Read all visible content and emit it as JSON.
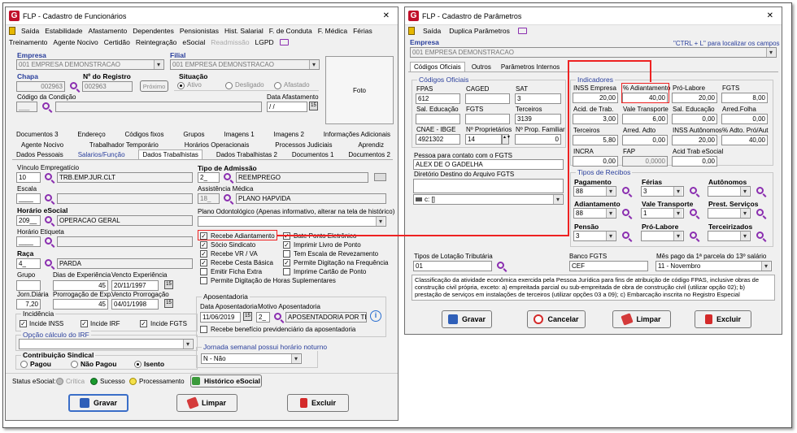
{
  "left": {
    "title": "FLP - Cadastro de Funcionários",
    "close": "✕",
    "menu1": [
      "Saída",
      "Estabilidade",
      "Afastamento",
      "Dependentes",
      "Pensionistas",
      "Hist. Salarial",
      "F. de Conduta",
      "F. Médica",
      "Férias"
    ],
    "menu2": [
      "Treinamento",
      "Agente Nocivo",
      "Certidão",
      "Reintegração",
      "eSocial",
      "Readmissão",
      "LGPD"
    ],
    "empresa_label": "Empresa",
    "empresa_value": "001 EMPRESA DEMONSTRACAO",
    "filial_label": "Filial",
    "filial_value": "001 EMPRESA DEMONSTRACAO",
    "chapa_label": "Chapa",
    "chapa_value": "002963",
    "registro_label": "Nº do Registro",
    "registro_value": "002963",
    "proximo": "Próximo",
    "situacao_label": "Situação",
    "sit_ativo": "Ativo",
    "sit_desligado": "Desligado",
    "sit_afastado": "Afastado",
    "foto": "Foto",
    "cond_label": "Código da Condição",
    "cond_value": "___",
    "dafast_label": "Data Afastamento",
    "dafast_value": "/ /",
    "tabs1": [
      "Documentos 3",
      "Endereço",
      "Códigos fixos",
      "Grupos",
      "Imagens 1",
      "Imagens 2",
      "Informações Adicionais"
    ],
    "tabs2": [
      "Agente Nocivo",
      "Trabalhador Temporário",
      "Horários Operacionais",
      "Processos Judiciais",
      "Aprendiz"
    ],
    "tabs3": [
      "Dados Pessoais",
      "Salarios/Função",
      "Dados Trabalhistas",
      "Dados Trabalhistas 2",
      "Documentos 1",
      "Documentos 2"
    ],
    "vinc_label": "Vínculo Empregatício",
    "vinc_code": "10",
    "vinc_desc": "TRB.EMP.JUR.CLT",
    "escala_label": "Escala",
    "escala_code": "____",
    "hor_label": "Horário eSocial",
    "hor_code": "209__",
    "hor_desc": "OPERACAO GERAL",
    "horet_label": "Horário Etiqueta",
    "horet_code": "____",
    "raca_label": "Raça",
    "raca_code": "4_",
    "raca_desc": "PARDA",
    "grupo_label": "Grupo",
    "grupo_value": "",
    "diasexp_label": "Dias de Experiência",
    "diasexp_value": "45",
    "vencexp_label": "Vencto Experiência",
    "vencexp_value": "20/11/1997",
    "jorn_label": "Jorn.Diária",
    "jorn_value": "7,20",
    "prorrog_label": "Prorrogação de Exp.",
    "prorrog_value": "45",
    "vencpro_label": "Vencto Prorrogação",
    "vencpro_value": "04/01/1998",
    "incid_label": "Incidência",
    "inss": "Incide INSS",
    "irf": "Incide IRF",
    "fgts": "Incide FGTS",
    "opcirf_label": "Opção cálculo do IRF",
    "contrib_label": "Contribuição Sindical",
    "pagou": "Pagou",
    "naopagou": "Não Pagou",
    "isento": "Isento",
    "tipoadm_label": "Tipo de Admissão",
    "tipoadm_code": "2_",
    "tipoadm_desc": "REEMPREGO",
    "assist_label": "Assistência Médica",
    "assist_code": "18_",
    "assist_desc": "PLANO HAPVIDA",
    "plano_label": "Plano Odontológico (Apenas informativo, alterar na tela de histórico)",
    "checks_left": [
      "Recebe Adiantamento",
      "Sócio Sindicato",
      "Recebe VR / VA",
      "Recebe Cesta Básica",
      "Emitir Ficha Extra",
      "Permite Digitação de Horas Suplementares"
    ],
    "checks_right": [
      "Bate Ponto Eletrônico",
      "Imprimir Livro de Ponto",
      "Tem Escala de Revezamento",
      "Permite Digitação na Frequência",
      "Imprime Cartão de Ponto"
    ],
    "apos_label": "Aposentadoria",
    "apos_data_label": "Data Aposentadoria",
    "apos_motivo_label": "Motivo Aposentadoria",
    "apos_data": "11/06/2019",
    "apos_code": "2_",
    "apos_desc": "APOSENTADORIA POR TEI",
    "apos_benef": "Recebe benefício previdenciário da aposentadoria",
    "jornada_label": "Jornada semanal possui horário noturno",
    "jornada_value": "N - Não",
    "status_label": "Status eSocial:",
    "st_critica": "Crítica",
    "st_sucesso": "Sucesso",
    "st_process": "Processamento",
    "hist": "Histórico eSocial",
    "gravar": "Gravar",
    "limpar": "Limpar",
    "excluir": "Excluir"
  },
  "right": {
    "title": "FLP - Cadastro de Parâmetros",
    "menu": [
      "Saída",
      "Duplica Parâmetros"
    ],
    "empresa_label": "Empresa",
    "empresa_value": "001 EMPRESA DEMONSTRACAO",
    "hint": "\"CTRL + L\" para localizar os campos",
    "tabs": [
      "Códigos Oficiais",
      "Outros",
      "Parâmetros Internos"
    ],
    "cod_label": "Códigos Oficiais",
    "fpas_label": "FPAS",
    "fpas": "612",
    "caged_label": "CAGED",
    "caged": "",
    "sat_label": "SAT",
    "sat": "3",
    "saled_label": "Sal. Educação",
    "saled": "",
    "fgts_label": "FGTS",
    "fgts": "",
    "terc_label": "Terceiros",
    "terc": "3139",
    "cnae_label": "CNAE - IBGE",
    "cnae": "4921302",
    "nprop_label": "Nº Proprietários",
    "nprop": "14",
    "nfam_label": "Nº Prop. Familiar",
    "nfam": "0",
    "contato_label": "Pessoa para contato com o FGTS",
    "contato": "ALEX DE O GADELHA",
    "dir_label": "Diretório Destino do Arquivo FGTS",
    "drive": "c: []",
    "ind_label": "Indicadores",
    "inss_emp_l": "INSS Empresa",
    "inss_emp": "20,00",
    "pct_adi_l": "% Adiantamento",
    "pct_adi": "40,00",
    "prolab_l": "Pró-Labore",
    "prolab": "20,00",
    "fgts2_l": "FGTS",
    "fgts2": "8,00",
    "acid_l": "Acid. de Trab.",
    "acid": "3,00",
    "vt_l": "Vale Transporte",
    "vt": "6,00",
    "saled2_l": "Sal. Educação",
    "saled2": "0,00",
    "arredf_l": "Arred.Folha",
    "arredf": "0,00",
    "terc2_l": "Terceiros",
    "terc2": "5,80",
    "arred_adto_l": "Arred. Adto",
    "arred_adto": "0,00",
    "inss_aut_l": "INSS Autônomos",
    "inss_aut": "20,00",
    "pct_aut_l": "% Adto. Pró/Aut",
    "pct_aut": "40,00",
    "incra_l": "INCRA",
    "incra": "0,00",
    "fap_l": "FAP",
    "fap": "0,0000",
    "acidrab_l": "Acid Trab eSocial",
    "acidrab": "0,00",
    "tiporec_label": "Tipos de Recibos",
    "pag_l": "Pagamento",
    "pag": "88",
    "ferias_l": "Férias",
    "ferias": "3",
    "auton_l": "Autônomos",
    "auton": "",
    "adi_l": "Adiantamento",
    "adi": "88",
    "vt2_l": "Vale Transporte",
    "vt2": "1",
    "prest_l": "Prest. Serviços",
    "prest": "",
    "pensao_l": "Pensão",
    "pensao": "3",
    "prolab2_l": "Pró-Labore",
    "prolab2": "",
    "terceir_l": "Terceirizados",
    "terceir": "",
    "lot_label": "Tipos de Lotação Tributária",
    "lot": "01",
    "banco_label": "Banco FGTS",
    "banco": "CEF",
    "mes_label": "Mês pago da 1ª parcela do 13º salário",
    "mes": "11 - Novembro",
    "desc": "Classificação da atividade econômica exercida pela Pessoa Jurídica para fins de atribuição de código FPAS, inclusive obras de construção civil própria, exceto: a) empreitada parcial ou sub-empreitada de obra de construção civil (utilizar opção 02); b) prestação de serviços em instalações de terceiros (utilizar opções 03 a 09); c) Embarcação inscrita no Registro Especial",
    "gravar": "Gravar",
    "cancelar": "Cancelar",
    "limpar": "Limpar",
    "excluir": "Excluir"
  }
}
